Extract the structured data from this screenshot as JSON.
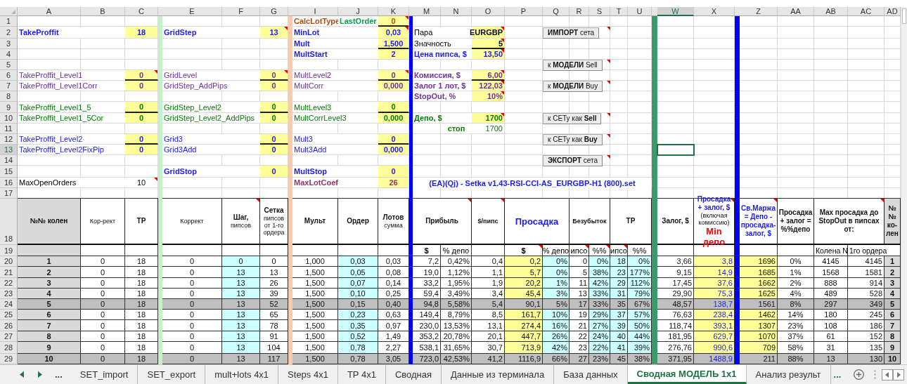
{
  "columns": [
    {
      "label": "A",
      "selected": false
    },
    {
      "label": "B",
      "selected": false
    },
    {
      "label": "C",
      "selected": false
    },
    {
      "selected": false
    },
    {
      "label": "E",
      "selected": false
    },
    {
      "label": "F",
      "selected": false
    },
    {
      "label": "G",
      "selected": false
    },
    {
      "selected": false
    },
    {
      "label": "I",
      "selected": false
    },
    {
      "label": "J",
      "selected": false
    },
    {
      "label": "K",
      "selected": false
    },
    {
      "selected": false
    },
    {
      "label": "M",
      "selected": false
    },
    {
      "label": "N",
      "selected": false
    },
    {
      "label": "O",
      "selected": false
    },
    {
      "label": "P",
      "selected": false
    },
    {
      "label": "Q",
      "selected": false
    },
    {
      "label": "R",
      "selected": false
    },
    {
      "label": "S",
      "selected": false
    },
    {
      "label": "T",
      "selected": false
    },
    {
      "label": "U",
      "selected": false
    },
    {
      "selected": false
    },
    {
      "label": "W",
      "selected": true
    },
    {
      "label": "X",
      "selected": false
    },
    {
      "selected": false
    },
    {
      "label": "Z",
      "selected": false
    },
    {
      "label": "AA",
      "selected": false
    },
    {
      "label": "AB",
      "selected": false
    },
    {
      "label": "AC",
      "selected": false
    },
    {
      "label": "AD",
      "selected": false
    }
  ],
  "row_numbers": [
    {
      "label": "1",
      "selected": false
    },
    {
      "label": "2",
      "selected": false
    },
    {
      "label": "3",
      "selected": false
    },
    {
      "label": "4",
      "selected": false
    },
    {
      "label": "5",
      "selected": false
    },
    {
      "label": "6",
      "selected": false
    },
    {
      "label": "7",
      "selected": false
    },
    {
      "label": "8",
      "selected": false
    },
    {
      "label": "9",
      "selected": false
    },
    {
      "label": "10",
      "selected": false
    },
    {
      "label": "11",
      "selected": false
    },
    {
      "label": "12",
      "selected": false
    },
    {
      "label": "13",
      "selected": true
    },
    {
      "label": "14",
      "selected": false
    },
    {
      "label": "15",
      "selected": false
    },
    {
      "label": "16",
      "selected": false
    },
    {
      "label": "17",
      "selected": false
    },
    {
      "label": "18",
      "selected": false
    },
    {
      "label": "19",
      "selected": false
    },
    {
      "label": "20",
      "selected": false
    },
    {
      "label": "21",
      "selected": false
    },
    {
      "label": "22",
      "selected": false
    },
    {
      "label": "23",
      "selected": false
    },
    {
      "label": "24",
      "selected": false
    },
    {
      "label": "25",
      "selected": false
    },
    {
      "label": "26",
      "selected": false
    },
    {
      "label": "27",
      "selected": false
    },
    {
      "label": "28",
      "selected": false
    },
    {
      "label": "29",
      "selected": false
    }
  ],
  "param_rows": [
    {
      "mult": {
        "label": "CalcLotType",
        "note": {
          "text": "LastOrder",
          "color": "#00a050"
        },
        "value": "0",
        "color": "#b04a10",
        "bold": true,
        "highlighted": true,
        "comment": true,
        "rule_below": true
      }
    },
    {
      "tp": {
        "label": "TakeProffit",
        "value": "18",
        "color": "#1a1aff",
        "bold": true,
        "highlighted": true,
        "comment": false,
        "rule_below": false
      },
      "grid": {
        "label": "GridStep",
        "value": "13",
        "color": "#1a1aff",
        "bold": true,
        "highlighted": true,
        "comment": true,
        "rule_below": false
      },
      "mult": {
        "label": "MinLot",
        "value": "0,03",
        "color": "#1a1aff",
        "bold": true,
        "highlighted": true,
        "comment": true,
        "rule_below": false
      },
      "info": {
        "kind": "main",
        "label": "Пара",
        "value": "EURGBP",
        "color": "#000000",
        "bold": false,
        "highlighted": true,
        "comment": true,
        "rule_below": false
      },
      "button": {
        "label": "**ИМПОРТ** сета",
        "comment": true
      }
    },
    {
      "mult": {
        "label": "Mult",
        "value": "1,500",
        "color": "#1a1aff",
        "bold": true,
        "highlighted": true,
        "comment": false,
        "rule_below": true
      },
      "info": {
        "kind": "main",
        "label": "Значность",
        "value": "5",
        "color": "#000000",
        "bold": false,
        "highlighted": true,
        "comment": true,
        "rule_below": true
      }
    },
    {
      "mult": {
        "label": "MultStart",
        "value": "2",
        "color": "#1a1aff",
        "bold": true,
        "highlighted": true,
        "comment": false,
        "rule_below": false
      },
      "info": {
        "kind": "main",
        "label": "Цена пипса, $",
        "value": "13,50",
        "color": "#1a1aff",
        "bold": true,
        "highlighted": true,
        "comment": true,
        "rule_below": false
      }
    },
    {
      "button": {
        "label": "к **МОДЕЛИ** Sell",
        "comment": true
      }
    },
    {
      "tp": {
        "label": "TakeProffit_Level1",
        "value": "0",
        "color": "#7030a0",
        "bold": false,
        "highlighted": true,
        "comment": true,
        "rule_below": true
      },
      "grid": {
        "label": "GridLevel",
        "value": "0",
        "color": "#7030a0",
        "bold": false,
        "highlighted": true,
        "comment": true,
        "rule_below": true
      },
      "mult": {
        "label": "MultLevel2",
        "value": "0",
        "color": "#7030a0",
        "bold": false,
        "highlighted": true,
        "comment": true,
        "rule_below": true
      },
      "info": {
        "kind": "main",
        "label": "Комиссия, $",
        "value": "6,00",
        "color": "#7030a0",
        "bold": true,
        "highlighted": true,
        "comment": true,
        "rule_below": true
      }
    },
    {
      "tp": {
        "label": "TakeProffit_Level1Corr",
        "value": "0",
        "color": "#7030a0",
        "bold": false,
        "highlighted": true,
        "comment": false,
        "rule_below": false
      },
      "grid": {
        "label": "GridStep_AddPips",
        "value": "0",
        "color": "#7030a0",
        "bold": false,
        "highlighted": true,
        "comment": false,
        "rule_below": false
      },
      "mult": {
        "label": "MultCorr",
        "value": "0,000",
        "color": "#7030a0",
        "bold": false,
        "highlighted": true,
        "comment": false,
        "rule_below": false
      },
      "info": {
        "kind": "main",
        "label": "Залог 1 лот, $",
        "value": "122,03",
        "color": "#7030a0",
        "bold": true,
        "highlighted": true,
        "comment": true,
        "rule_below": false
      },
      "button": {
        "label": "к **МОДЕЛИ** Buy",
        "comment": true
      }
    },
    {
      "info": {
        "kind": "main",
        "label": "StopOut, %",
        "value": "10%",
        "color": "#7030a0",
        "bold": true,
        "highlighted": true,
        "comment": true,
        "rule_below": false
      }
    },
    {
      "tp": {
        "label": "TakeProffit_Level1_5",
        "value": "0",
        "color": "#008000",
        "bold": false,
        "highlighted": true,
        "comment": false,
        "rule_below": true
      },
      "grid": {
        "label": "GridStep_Level2",
        "value": "0",
        "color": "#008000",
        "bold": false,
        "highlighted": true,
        "comment": false,
        "rule_below": true
      },
      "mult": {
        "label": "MultLevel3",
        "value": "0",
        "color": "#008000",
        "bold": false,
        "highlighted": true,
        "comment": false,
        "rule_below": true
      }
    },
    {
      "tp": {
        "label": "TakeProffit_Level1_5Cor",
        "value": "0",
        "color": "#008000",
        "bold": false,
        "highlighted": true,
        "comment": false,
        "rule_below": false
      },
      "grid": {
        "label": "GridStep_Level2_AddPips",
        "value": "0",
        "color": "#008000",
        "bold": false,
        "highlighted": true,
        "comment": false,
        "rule_below": false
      },
      "mult": {
        "label": "MultCorrLevel3",
        "value": "0,000",
        "color": "#008000",
        "bold": false,
        "highlighted": true,
        "comment": false,
        "rule_below": false
      },
      "info": {
        "kind": "main",
        "label": "Депо, $",
        "value": "1700",
        "color": "#008000",
        "bold": true,
        "highlighted": true,
        "comment": true,
        "rule_below": false
      },
      "button": {
        "label": "к СЕТу как **Sell**",
        "comment": true
      }
    },
    {
      "info": {
        "kind": "sub",
        "label": "стоп",
        "value": "1700",
        "color": "#008000",
        "bold": true,
        "highlighted": false,
        "comment": false,
        "rule_below": false
      }
    },
    {
      "tp": {
        "label": "TakeProffit_Level2",
        "value": "0",
        "color": "#1a1aff",
        "bold": false,
        "highlighted": true,
        "comment": false,
        "rule_below": true
      },
      "grid": {
        "label": "Grid3",
        "value": "0",
        "color": "#1a1aff",
        "bold": false,
        "highlighted": true,
        "comment": false,
        "rule_below": true
      },
      "mult": {
        "label": "Mult3",
        "value": "0",
        "color": "#1a1aff",
        "bold": false,
        "highlighted": true,
        "comment": false,
        "rule_below": true
      },
      "button": {
        "label": "к СЕТу как **Buy**",
        "comment": true
      }
    },
    {
      "tp": {
        "label": "TakeProffit_Level2FixPip",
        "value": "0",
        "color": "#1a1aff",
        "bold": false,
        "highlighted": true,
        "comment": false,
        "rule_below": false
      },
      "grid": {
        "label": "Grid3Add",
        "value": "0",
        "color": "#1a1aff",
        "bold": false,
        "highlighted": true,
        "comment": false,
        "rule_below": false
      },
      "mult": {
        "label": "Mult3Add",
        "value": "0,000",
        "color": "#1a1aff",
        "bold": false,
        "highlighted": true,
        "comment": false,
        "rule_below": false
      }
    },
    {
      "button": {
        "label": "**ЭКСПОРТ** сета",
        "comment": true
      }
    },
    {
      "grid": {
        "label": "GridStop",
        "value": "0",
        "color": "#1a1aff",
        "bold": true,
        "highlighted": true,
        "comment": false,
        "rule_below": false
      },
      "mult": {
        "label": "MultStop",
        "value": "0",
        "color": "#1a1aff",
        "bold": true,
        "highlighted": true,
        "comment": false,
        "rule_below": false
      }
    },
    {
      "tp": {
        "label": "MaxOpenOrders",
        "value": "10",
        "color": "#000000",
        "bold": false,
        "highlighted": false,
        "comment": true,
        "rule_below": false
      },
      "mult": {
        "label": "MaxLotCoef",
        "value": "26",
        "color": "#993366",
        "bold": true,
        "highlighted": true,
        "comment": false,
        "rule_below": false
      }
    }
  ],
  "set_file_name": "(EA)(Qj) - Setka v1.43-RSI-CCI-AS_EURGBP-H1 (800).set",
  "order_table": {
    "headers": [
      {
        "lines": [
          {
            "kind": "title",
            "text": "№№ колен"
          }
        ],
        "comment": false
      },
      {
        "lines": [
          {
            "kind": "note",
            "text": "Кор-рект"
          }
        ],
        "comment": false
      },
      {
        "lines": [
          {
            "kind": "title",
            "text": "TP"
          }
        ],
        "comment": false
      },
      {
        "lines": [
          {
            "kind": "note",
            "text": "Коррект"
          }
        ],
        "comment": false
      },
      {
        "lines": [
          {
            "kind": "title",
            "text": "Шаг,"
          },
          {
            "kind": "note",
            "text": "пипсов"
          }
        ],
        "comment": true
      },
      {
        "lines": [
          {
            "kind": "title",
            "text": "Сетка"
          },
          {
            "kind": "note",
            "text": "пипсов от 1-го ордера"
          }
        ],
        "comment": false
      },
      {
        "lines": [
          {
            "kind": "title",
            "text": "Мульт"
          }
        ],
        "comment": false
      },
      {
        "lines": [
          {
            "kind": "title",
            "text": "Ордер"
          }
        ],
        "comment": false
      },
      {
        "lines": [
          {
            "kind": "title",
            "text": "Лотов"
          },
          {
            "kind": "note",
            "text": "сумма"
          }
        ],
        "comment": false
      },
      {
        "lines": [
          {
            "kind": "title",
            "text": "Прибыль"
          }
        ],
        "comment": true
      },
      {
        "lines": [
          {
            "kind": "small_title",
            "text": "$/пипс"
          }
        ],
        "comment": true
      },
      {
        "lines": [
          {
            "kind": "large",
            "text": "Просадка",
            "color": "#1a1aff"
          }
        ],
        "comment": false
      },
      {
        "lines": [
          {
            "kind": "small_title",
            "text": "Безубыток"
          }
        ],
        "comment": false
      },
      {
        "lines": [
          {
            "kind": "title",
            "text": "TP"
          }
        ],
        "comment": false
      },
      {
        "lines": [
          {
            "kind": "title",
            "text": "Залог, $"
          }
        ],
        "comment": false
      },
      {
        "lines": [
          {
            "kind": "title",
            "text": "Просадка + залог, $",
            "color": "#1a1aff"
          },
          {
            "kind": "note",
            "text": "(включая комиссию)"
          },
          {
            "kind": "large",
            "text": "Min депо",
            "color": "#ff0000"
          }
        ],
        "comment": true
      },
      {
        "lines": [
          {
            "kind": "title",
            "text": "Св.Маржа = Депо - просадка-залог, $",
            "color": "#1a1aff"
          }
        ],
        "comment": true
      },
      {
        "lines": [
          {
            "kind": "title",
            "text": "Просадка + залог = %%депо"
          }
        ],
        "comment": false
      },
      {
        "lines": [
          {
            "kind": "title",
            "text": "Max просадка до StopOut в пипсах от:"
          }
        ],
        "comment": true
      },
      {
        "lines": [
          {
            "kind": "title",
            "text": "№№ ко-лен"
          }
        ],
        "comment": false
      }
    ],
    "subheaders": [
      {
        "text": "$",
        "bold": true,
        "comment": false
      },
      {
        "text": "% депо",
        "bold": false,
        "comment": false
      },
      {
        "text": "$",
        "bold": true,
        "comment": true
      },
      {
        "text": "% депо",
        "bold": false,
        "comment": false
      },
      {
        "text": "ипсо",
        "bold": false,
        "comment": true
      },
      {
        "text": "%%",
        "bold": false,
        "comment": true
      },
      {
        "text": "ипсо",
        "bold": false,
        "comment": true
      },
      {
        "text": "%%",
        "bold": false,
        "comment": false
      },
      {
        "text": "Колена N",
        "bold": false,
        "comment": false
      },
      {
        "text": "1го ордера",
        "bold": false,
        "comment": false
      }
    ],
    "rows": [
      {
        "shaded": false,
        "cells": [
          "1",
          "0",
          "18",
          "0",
          "0",
          "0",
          "1,000",
          "0,03",
          "0,03",
          "7,2",
          "0,42%",
          "0,4",
          "0,2",
          "0%",
          "0",
          "0%",
          "18",
          "0%",
          "3,66",
          "3,8",
          "1696",
          "0%",
          "4145",
          "4145",
          "1"
        ]
      },
      {
        "shaded": false,
        "cells": [
          "2",
          "0",
          "18",
          "0",
          "13",
          "13",
          "1,500",
          "0,05",
          "0,08",
          "19,0",
          "1,12%",
          "1,1",
          "5,7",
          "0%",
          "5",
          "38%",
          "23",
          "177%",
          "9,15",
          "14,9",
          "1685",
          "1%",
          "1568",
          "1581",
          "2"
        ]
      },
      {
        "shaded": false,
        "cells": [
          "3",
          "0",
          "18",
          "0",
          "13",
          "26",
          "1,500",
          "0,07",
          "0,14",
          "33,2",
          "1,95%",
          "1,9",
          "20,2",
          "1%",
          "11",
          "42%",
          "29",
          "112%",
          "17,45",
          "37,6",
          "1662",
          "2%",
          "888",
          "914",
          "3"
        ]
      },
      {
        "shaded": false,
        "cells": [
          "4",
          "0",
          "18",
          "0",
          "13",
          "39",
          "1,500",
          "0,10",
          "0,25",
          "59,4",
          "3,49%",
          "3,4",
          "45,4",
          "3%",
          "13",
          "33%",
          "31",
          "79%",
          "29,90",
          "75,3",
          "1625",
          "4%",
          "489",
          "528",
          "4"
        ]
      },
      {
        "shaded": true,
        "cells": [
          "5",
          "0",
          "18",
          "0",
          "13",
          "52",
          "1,500",
          "0,15",
          "0,40",
          "94,8",
          "5,58%",
          "5,4",
          "90,1",
          "5%",
          "17",
          "33%",
          "35",
          "67%",
          "48,57",
          "138,7",
          "1561",
          "8%",
          "297",
          "349",
          "5"
        ]
      },
      {
        "shaded": false,
        "cells": [
          "6",
          "0",
          "18",
          "0",
          "13",
          "65",
          "1,500",
          "0,23",
          "0,63",
          "149,4",
          "8,79%",
          "8,5",
          "161,7",
          "10%",
          "19",
          "29%",
          "37",
          "57%",
          "76,63",
          "238,4",
          "1462",
          "14%",
          "180",
          "245",
          "6"
        ]
      },
      {
        "shaded": false,
        "cells": [
          "7",
          "0",
          "18",
          "0",
          "13",
          "78",
          "1,500",
          "0,35",
          "0,97",
          "230,0",
          "13,53%",
          "13,1",
          "274,4",
          "16%",
          "21",
          "27%",
          "39",
          "50%",
          "118,74",
          "393,1",
          "1307",
          "23%",
          "108",
          "186",
          "7"
        ]
      },
      {
        "shaded": false,
        "cells": [
          "8",
          "0",
          "18",
          "0",
          "13",
          "91",
          "1,500",
          "0,52",
          "1,49",
          "353,2",
          "20,78%",
          "20,1",
          "447,7",
          "26%",
          "22",
          "24%",
          "40",
          "44%",
          "181,95",
          "629,7",
          "1070",
          "37%",
          "61",
          "152",
          "8"
        ]
      },
      {
        "shaded": false,
        "cells": [
          "9",
          "0",
          "18",
          "0",
          "13",
          "104",
          "1,500",
          "0,78",
          "2,27",
          "538,1",
          "31,65%",
          "30,7",
          "713,9",
          "42%",
          "23",
          "22%",
          "41",
          "39%",
          "276,76",
          "990,6",
          "709",
          "58%",
          "31",
          "135",
          "9"
        ]
      },
      {
        "shaded": true,
        "cells": [
          "10",
          "0",
          "18",
          "0",
          "13",
          "117",
          "1,500",
          "0,78",
          "3,05",
          "723,0",
          "42,53%",
          "41,2",
          "1116,9",
          "66%",
          "27",
          "23%",
          "45",
          "38%",
          "371,95",
          "1488,9",
          "211",
          "88%",
          "13",
          "130",
          "10"
        ]
      }
    ]
  },
  "sheet_tabs": {
    "overflow_left": "...",
    "tabs": [
      {
        "label": "SET_import",
        "selected": false
      },
      {
        "label": "SET_export",
        "selected": false
      },
      {
        "label": "mult+lots 4x1",
        "selected": false
      },
      {
        "label": "Steps 4x1",
        "selected": false
      },
      {
        "label": "TP 4x1",
        "selected": false
      },
      {
        "label": "Сводная",
        "selected": false
      },
      {
        "label": "Данные из терминала",
        "selected": false
      },
      {
        "label": "База данных",
        "selected": false
      },
      {
        "label": "Сводная МОДЕЛЬ 1x1",
        "selected": true
      },
      {
        "label": "Анализ результ",
        "selected": false
      }
    ],
    "overflow_right": "..."
  }
}
